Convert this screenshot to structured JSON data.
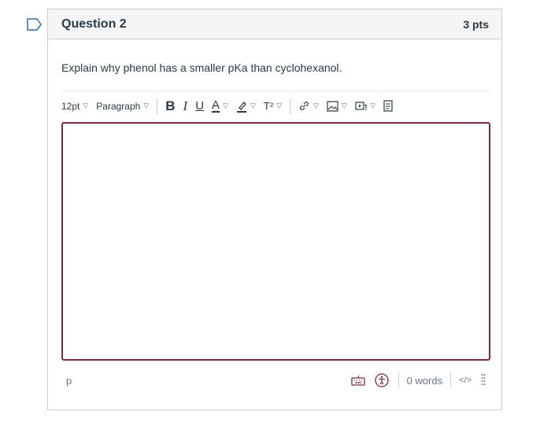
{
  "question": {
    "title": "Question 2",
    "points": "3 pts",
    "text": "Explain why phenol has a smaller pKa than cyclohexanol."
  },
  "toolbar": {
    "font_size": "12pt",
    "block_format": "Paragraph",
    "superscript": "T²"
  },
  "statusbar": {
    "path": "p",
    "word_count": "0 words",
    "html_toggle": "</>"
  },
  "icons": {
    "flag": "bookmark-flag-icon",
    "bold": "bold-icon",
    "italic": "italic-icon",
    "underline": "underline-icon",
    "font_color": "font-color-icon",
    "highlight": "highlight-icon",
    "link": "link-icon",
    "image": "image-icon",
    "media": "media-icon",
    "document": "document-icon",
    "keyboard": "keyboard-icon",
    "accessibility": "accessibility-icon",
    "resize": "resize-handle-icon"
  },
  "colors": {
    "editor_border": "#7b2d3b",
    "accent": "#7b2d3b",
    "text": "#2d3b45"
  }
}
